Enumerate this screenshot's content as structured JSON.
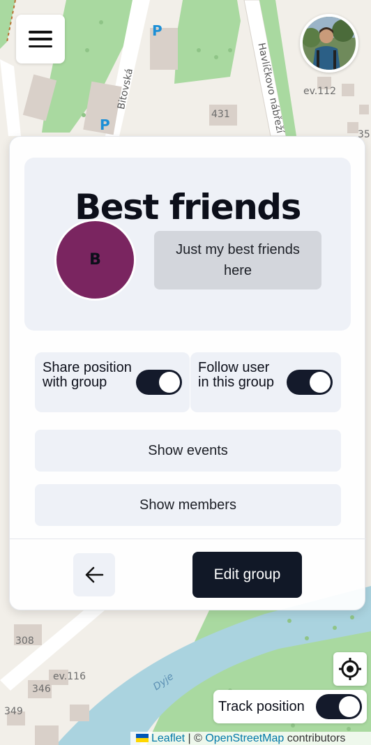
{
  "map": {
    "street_labels": [
      "Bitovská",
      "Havlíčkovo nábřeží",
      "Havlíčkovo"
    ],
    "river_label": "Dyje",
    "house_numbers": [
      "ev.112",
      "431",
      "35",
      "308",
      "ev.116",
      "346",
      "349"
    ],
    "parking_label": "P"
  },
  "top": {
    "menu_icon": "hamburger-menu-icon",
    "profile_icon": "user-avatar"
  },
  "group": {
    "title": "Best friends",
    "avatar_letter": "B",
    "avatar_color": "#7a2560",
    "description": "Just my best friends here",
    "toggles": [
      {
        "label": "Share position with group",
        "on": true
      },
      {
        "label": "Follow user in this group",
        "on": true
      }
    ],
    "show_events_label": "Show events",
    "show_members_label": "Show members",
    "back_icon": "arrow-left-icon",
    "edit_label": "Edit group"
  },
  "controls": {
    "locate_icon": "crosshair-icon",
    "track_label": "Track position",
    "track_on": true
  },
  "attribution": {
    "leaflet": "Leaflet",
    "separator": " | © ",
    "osm": "OpenStreetMap",
    "contributors": " contributors"
  },
  "colors": {
    "primary": "#111827",
    "switch_on": "#141a2b",
    "card_bg": "#eef1f7"
  }
}
